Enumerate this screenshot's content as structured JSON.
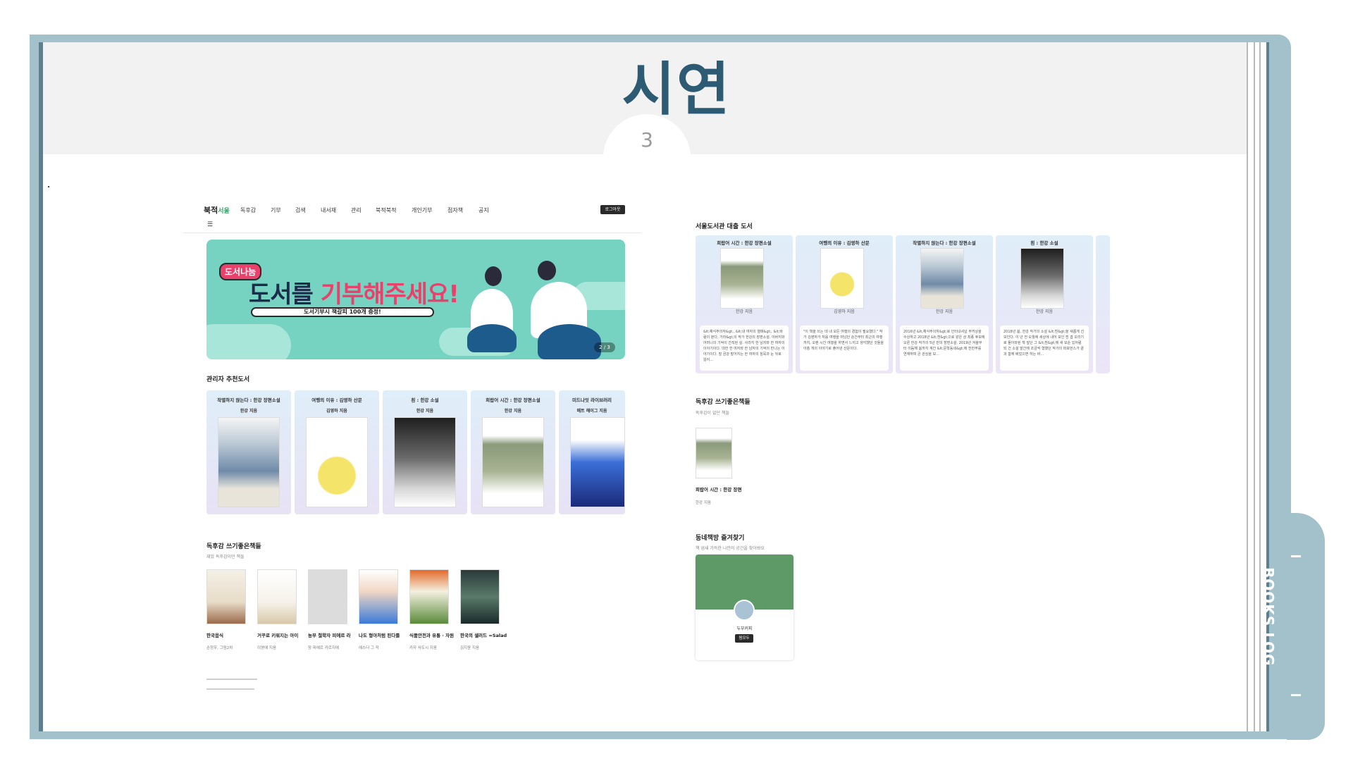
{
  "slide": {
    "title": "시연",
    "number": "3",
    "side_label": "BOOKS LOG",
    "colors": {
      "frame": "#a3c1cb",
      "title": "#2c5b73",
      "accent": "#3aa66b",
      "banner": "#76d3c1",
      "banner_pink": "#e8416b"
    }
  },
  "nav": {
    "logo_main": "북적",
    "logo_sub": "서울",
    "items": [
      "독후감",
      "기부",
      "검색",
      "내서재",
      "관리",
      "북적북적",
      "개인기부",
      "점자책",
      "공지"
    ],
    "login_label": "로그아웃",
    "menu_icon": "hamburger-icon"
  },
  "banner": {
    "tag": "도서나눔",
    "title_plain": "도서를 ",
    "title_pink": "기부해주세요!",
    "subtitle": "도서기부시 책갈피 100개 증정!",
    "pager": "2 / 3"
  },
  "recommended": {
    "title": "관리자 추천도서",
    "cards": [
      {
        "title": "작별하지 않는다 : 한강 장편소설",
        "author": "한강 지음"
      },
      {
        "title": "여행의 이유 : 김영하 산문",
        "author": "김영하 지음"
      },
      {
        "title": "흰 : 한강 소설",
        "author": "한강 지음"
      },
      {
        "title": "희랍어 시간 : 한강 장편소설",
        "author": "한강 지음"
      },
      {
        "title": "미드나잇 라이브러리",
        "author": "매트 헤이그 지음"
      }
    ]
  },
  "review_books": {
    "title": "독후감 쓰기좋은책들",
    "subtitle": "재밌 독후감이던 책들",
    "books": [
      {
        "title": "한국음식",
        "author": "손정우, 그림2차"
      },
      {
        "title": "거꾸로 키워지는 아이",
        "author": "이영애 지음"
      },
      {
        "title": "농부 철학자 피에르 라",
        "author": "장 피에르 카르지에"
      },
      {
        "title": "나도 형아처럼 된다를",
        "author": "에스더 그 작"
      },
      {
        "title": "식품안전과 유통 · 자원",
        "author": "카자 사도시 지음"
      },
      {
        "title": "한국의 샐러드 =Salad",
        "author": "김지윤 지음"
      }
    ]
  },
  "loans": {
    "title": "서울도서관 대출 도서",
    "cards": [
      {
        "title": "희랍어 시간 : 한강 장편소설",
        "author": "한강 지음",
        "desc": "&lt;채식주의자&gt;, &lt;내 여자의 열매&gt;, &lt;바람이 분다, 가라&gt;의 작가 한강의 장편소설. 아버지와 어머니의 기억이 간직된 실. 사라지 한 남자와 한 여자의 이야기이다. 대한 한 여자와 한 남자의 기억의 만나는 이야기이다. 말 금강 발어지는 한 여자의 침묵과 눈 뒤로 잃어..."
      },
      {
        "title": "여행의 이유 : 김영하 산문",
        "author": "김영하 지음",
        "desc": "\"이 책을 쓰는 데 내 모든 여행의 경험이 필요했다.\" 작가 김영하가 처음 여행을 떠났던 순간부터 최근의 여행까지, 오랜 시간 여행을 하면서 느끼고 생각했던 것들을 아홉 개의 이야기로 풀어낸 산문이다."
      },
      {
        "title": "작별하지 않는다 : 한강 장편소설",
        "author": "한강 지음",
        "desc": "2016년 &lt;채식주의자&gt;로 인터내셔널 부커상을 수상하고 2018년 &lt;흰&gt;으로 같은 상 최종 후보에 오른 한강 작가의 5년 만의 장편소설. 2019년 겨울부터 이듬해 봄까지 계간 &lt;문학동네&gt;에 전반부를 연재하며 큰 관심을 모..."
      },
      {
        "title": "흰 : 한강 소설",
        "author": "한강 지음",
        "desc": "2018년 봄, 한강 작가의 소설 &lt;흰&gt;을 새롭게 선보인다. 이 년 전 오월에 세상에 내어 보인 흰 겹 오라기로 돌아와된 책 앞단 그 &lt;흰&gt;에 새 모순 있처럼 되 건 소설 발간에 조금씩 형했던 작가의 퍼포먼스가 끝과 함께 배었으면 하는 바..."
      }
    ]
  },
  "review_right": {
    "title": "독후감 쓰기좋은책들",
    "subtitle": "독후감이 없던 책들",
    "book_title": "희랍어 시간 : 한강 장편",
    "book_author": "한강 지음"
  },
  "bookstore": {
    "title": "동네책방 즐겨찾기",
    "subtitle": "책 냄새 가득한 나만의 공간을 찾아봐요",
    "name": "두부커피",
    "button": "찜모두"
  }
}
